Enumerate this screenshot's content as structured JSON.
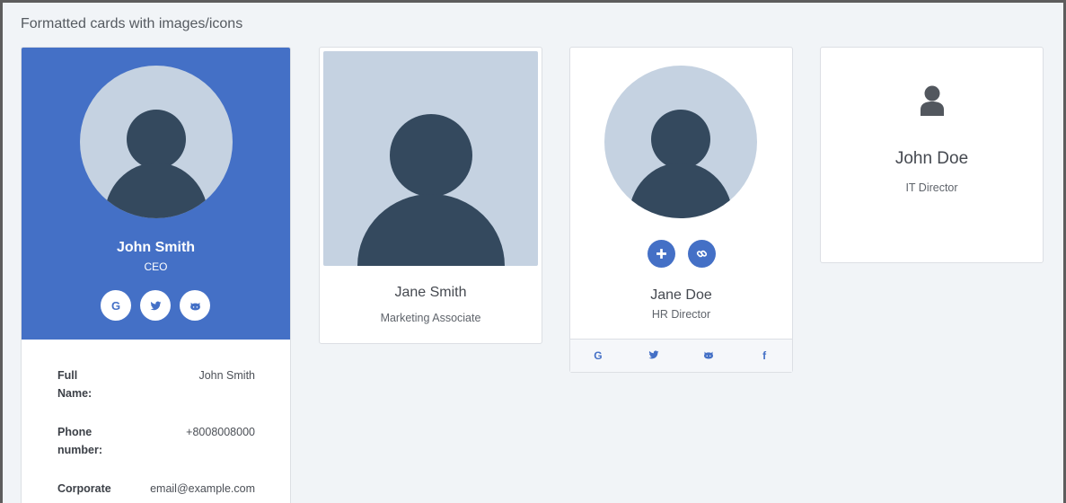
{
  "page": {
    "title": "Formatted cards with images/icons"
  },
  "colors": {
    "accent": "#4470c6",
    "avatar_bg": "#c5d2e1",
    "silhouette": "#34495e"
  },
  "card1": {
    "name": "John Smith",
    "role": "CEO",
    "social": [
      "google-icon",
      "twitter-icon",
      "github-icon"
    ],
    "social_glyphs": {
      "google": "G"
    },
    "details": [
      {
        "label": "Full Name:",
        "value": "John Smith"
      },
      {
        "label": "Phone number:",
        "value": "+8008008000"
      },
      {
        "label": "Corporate",
        "value": "email@example.com"
      }
    ]
  },
  "card2": {
    "name": "Jane Smith",
    "role": "Marketing Associate"
  },
  "card3": {
    "name": "Jane Doe",
    "role": "HR Director",
    "actions": [
      "plus-icon",
      "link-icon"
    ],
    "footer_glyphs": {
      "google": "G",
      "facebook": "f"
    }
  },
  "card4": {
    "name": "John Doe",
    "role": "IT Director"
  }
}
